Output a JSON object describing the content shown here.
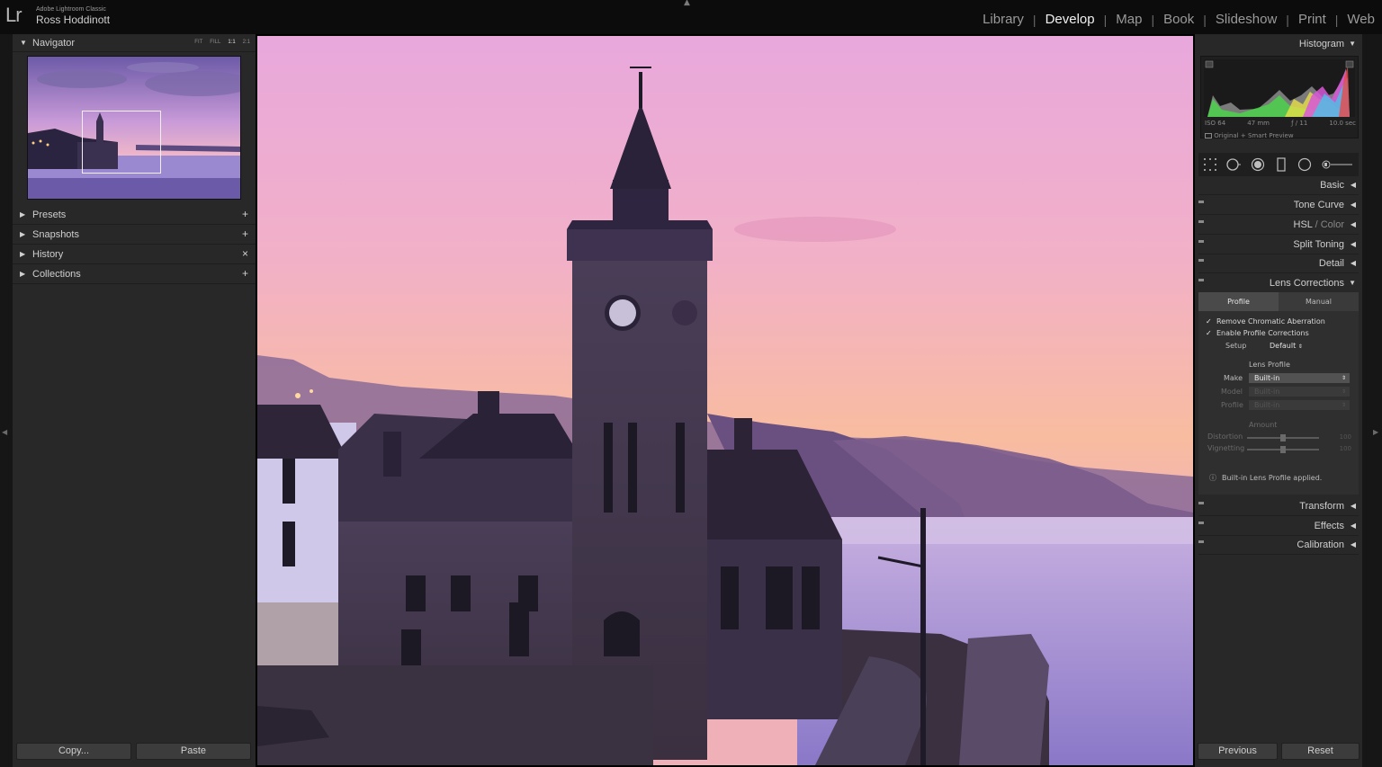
{
  "topbar": {
    "logo": "Lr",
    "app_name": "Adobe Lightroom Classic",
    "user_name": "Ross Hoddinott",
    "modules": [
      "Library",
      "Develop",
      "Map",
      "Book",
      "Slideshow",
      "Print",
      "Web"
    ],
    "active_module": "Develop"
  },
  "left_panel": {
    "navigator": {
      "title": "Navigator",
      "zoom_options": [
        "FIT",
        "FILL",
        "1:1",
        "2:1"
      ],
      "active_zoom": "1:1"
    },
    "sections": [
      {
        "label": "Presets",
        "action": "+"
      },
      {
        "label": "Snapshots",
        "action": "+"
      },
      {
        "label": "History",
        "action": "×"
      },
      {
        "label": "Collections",
        "action": "+"
      }
    ],
    "copy_button": "Copy...",
    "paste_button": "Paste"
  },
  "right_panel": {
    "histogram": {
      "title": "Histogram",
      "iso": "ISO 64",
      "focal_length": "47 mm",
      "aperture": "ƒ / 11",
      "shutter": "10.0 sec",
      "preview_label": "Original + Smart Preview"
    },
    "panels": {
      "basic": "Basic",
      "tone_curve": "Tone Curve",
      "hsl": "HSL",
      "color": "Color",
      "split_toning": "Split Toning",
      "detail": "Detail",
      "lens_corrections": "Lens Corrections",
      "transform": "Transform",
      "effects": "Effects",
      "calibration": "Calibration"
    },
    "lens": {
      "tabs": [
        "Profile",
        "Manual"
      ],
      "active_tab": "Profile",
      "remove_ca": "Remove Chromatic Aberration",
      "enable_profile": "Enable Profile Corrections",
      "setup_label": "Setup",
      "setup_value": "Default",
      "lens_profile_title": "Lens Profile",
      "make_label": "Make",
      "make_value": "Built-in",
      "model_label": "Model",
      "model_value": "Built-in",
      "profile_label": "Profile",
      "profile_value": "Built-in",
      "amount_title": "Amount",
      "distortion_label": "Distortion",
      "distortion_value": "100",
      "vignetting_label": "Vignetting",
      "vignetting_value": "100",
      "info_text": "Built-in Lens Profile applied."
    },
    "previous_button": "Previous",
    "reset_button": "Reset"
  },
  "colors": {
    "panel_bg": "#282828",
    "topbar_bg": "#0c0c0c",
    "active_text": "#f0f0f0",
    "sky_top": "#e6a8d8",
    "sky_bottom": "#f6b89a",
    "sea": "#a890d8"
  }
}
